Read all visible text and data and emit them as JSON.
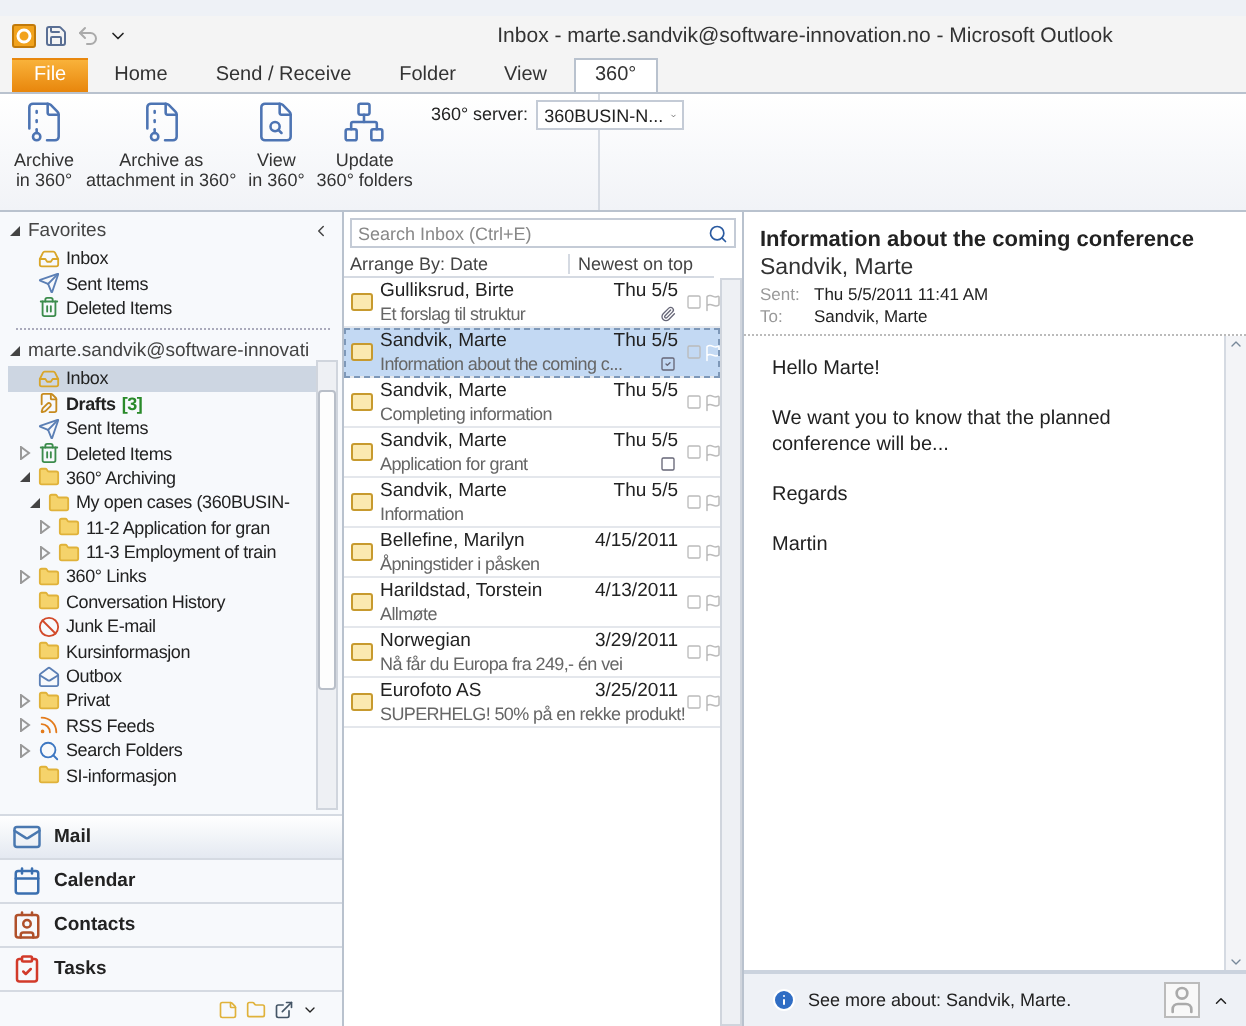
{
  "window": {
    "title": "Inbox - marte.sandvik@software-innovation.no  -  Microsoft Outlook"
  },
  "tabs": [
    {
      "label": "File",
      "kind": "file",
      "selected": false
    },
    {
      "label": "Home",
      "kind": "tab",
      "selected": false
    },
    {
      "label": "Send / Receive",
      "kind": "tab",
      "selected": false
    },
    {
      "label": "Folder",
      "kind": "tab",
      "selected": false
    },
    {
      "label": "View",
      "kind": "tab",
      "selected": false
    },
    {
      "label": "360°",
      "kind": "tab",
      "selected": true
    }
  ],
  "ribbon": {
    "buttons": [
      {
        "lines": [
          "Archive",
          "in 360°"
        ],
        "kind": "archive"
      },
      {
        "lines": [
          "Archive as",
          "attachment in 360°"
        ],
        "kind": "attach"
      },
      {
        "lines": [
          "View",
          "in 360°"
        ],
        "kind": "view"
      },
      {
        "lines": [
          "Update",
          "360° folders"
        ],
        "kind": "update"
      }
    ],
    "server_label": "360° server:",
    "server_value": "360BUSIN-N..."
  },
  "folder_pane": {
    "sections": [
      {
        "label": "Favorites",
        "expanded": true,
        "folders": [
          {
            "label": "Inbox",
            "kind": "inbox",
            "selected": false
          },
          {
            "label": "Sent Items",
            "kind": "sent",
            "selected": false
          },
          {
            "label": "Deleted Items",
            "kind": "deleted",
            "selected": false
          }
        ]
      },
      {
        "label": "marte.sandvik@software-innovati",
        "expanded": true,
        "folders": [
          {
            "label": "Inbox",
            "kind": "inbox",
            "selected": true
          },
          {
            "label": "Drafts",
            "kind": "drafts",
            "selected": false,
            "count": "[3]"
          },
          {
            "label": "Sent Items",
            "kind": "sent",
            "selected": false
          },
          {
            "label": "Deleted Items",
            "kind": "deleted",
            "selected": false,
            "expanded": false
          },
          {
            "label": "360° Archiving",
            "kind": "folder",
            "selected": false,
            "expanded": true,
            "children": [
              {
                "label": "My open cases (360BUSIN-",
                "kind": "folder",
                "selected": false,
                "expanded": true,
                "children": [
                  {
                    "label": "11-2 Application for gran",
                    "kind": "folder",
                    "selected": false,
                    "expanded": false
                  },
                  {
                    "label": "11-3 Employment of train",
                    "kind": "folder",
                    "selected": false,
                    "expanded": false
                  }
                ]
              }
            ]
          },
          {
            "label": "360° Links",
            "kind": "folder",
            "selected": false,
            "expanded": false
          },
          {
            "label": "Conversation History",
            "kind": "folder",
            "selected": false
          },
          {
            "label": "Junk E-mail",
            "kind": "junk",
            "selected": false
          },
          {
            "label": "Kursinformasjon",
            "kind": "folder",
            "selected": false
          },
          {
            "label": "Outbox",
            "kind": "outbox",
            "selected": false
          },
          {
            "label": "Privat",
            "kind": "folder",
            "selected": false,
            "expanded": false
          },
          {
            "label": "RSS Feeds",
            "kind": "rss",
            "selected": false,
            "expanded": false
          },
          {
            "label": "Search Folders",
            "kind": "search",
            "selected": false,
            "expanded": false
          },
          {
            "label": "SI-informasjon",
            "kind": "folder",
            "selected": false
          }
        ]
      }
    ]
  },
  "navigation": [
    {
      "label": "Mail",
      "kind": "mail",
      "selected": true
    },
    {
      "label": "Calendar",
      "kind": "calendar",
      "selected": false
    },
    {
      "label": "Contacts",
      "kind": "contacts",
      "selected": false
    },
    {
      "label": "Tasks",
      "kind": "tasks",
      "selected": false
    }
  ],
  "message_list": {
    "search": {
      "placeholder": "Search Inbox (Ctrl+E)"
    },
    "arrange_by": "Arrange By: Date",
    "sort_order": "Newest on top",
    "messages": [
      {
        "sender": "Gulliksrud, Birte",
        "date": "Thu 5/5",
        "subject": "Et forslag til struktur",
        "selected": false,
        "kind": "attachment"
      },
      {
        "sender": "Sandvik, Marte",
        "date": "Thu 5/5",
        "subject": "Information about the coming c...",
        "selected": true,
        "kind": "checked"
      },
      {
        "sender": "Sandvik, Marte",
        "date": "Thu 5/5",
        "subject": "Completing information",
        "selected": false,
        "kind": "plain"
      },
      {
        "sender": "Sandvik, Marte",
        "date": "Thu 5/5",
        "subject": "Application for grant",
        "selected": false,
        "kind": "unchecked"
      },
      {
        "sender": "Sandvik, Marte",
        "date": "Thu 5/5",
        "subject": "Information",
        "selected": false,
        "kind": "plain"
      },
      {
        "sender": "Bellefine, Marilyn",
        "date": "4/15/2011",
        "subject": "Åpningstider i påsken",
        "selected": false,
        "kind": "plain"
      },
      {
        "sender": "Harildstad, Torstein",
        "date": "4/13/2011",
        "subject": "Allmøte",
        "selected": false,
        "kind": "plain"
      },
      {
        "sender": "Norwegian",
        "date": "3/29/2011",
        "subject": "Nå får du Europa fra 249,- én vei",
        "selected": false,
        "kind": "plain"
      },
      {
        "sender": "Eurofoto AS",
        "date": "3/25/2011",
        "subject": "SUPERHELG! 50% på en rekke produkt!",
        "selected": false,
        "kind": "plain"
      }
    ]
  },
  "reading_pane": {
    "subject": "Information about the coming conference",
    "from": "Sandvik, Marte",
    "sent_label": "Sent:",
    "sent": "Thu 5/5/2011 11:41 AM",
    "to_label": "To:",
    "to": "Sandvik, Marte",
    "body": [
      "Hello Marte!",
      "We want you to know that the planned conference will be...",
      "Regards",
      "Martin"
    ],
    "people_pane": "See more about: Sandvik, Marte."
  }
}
